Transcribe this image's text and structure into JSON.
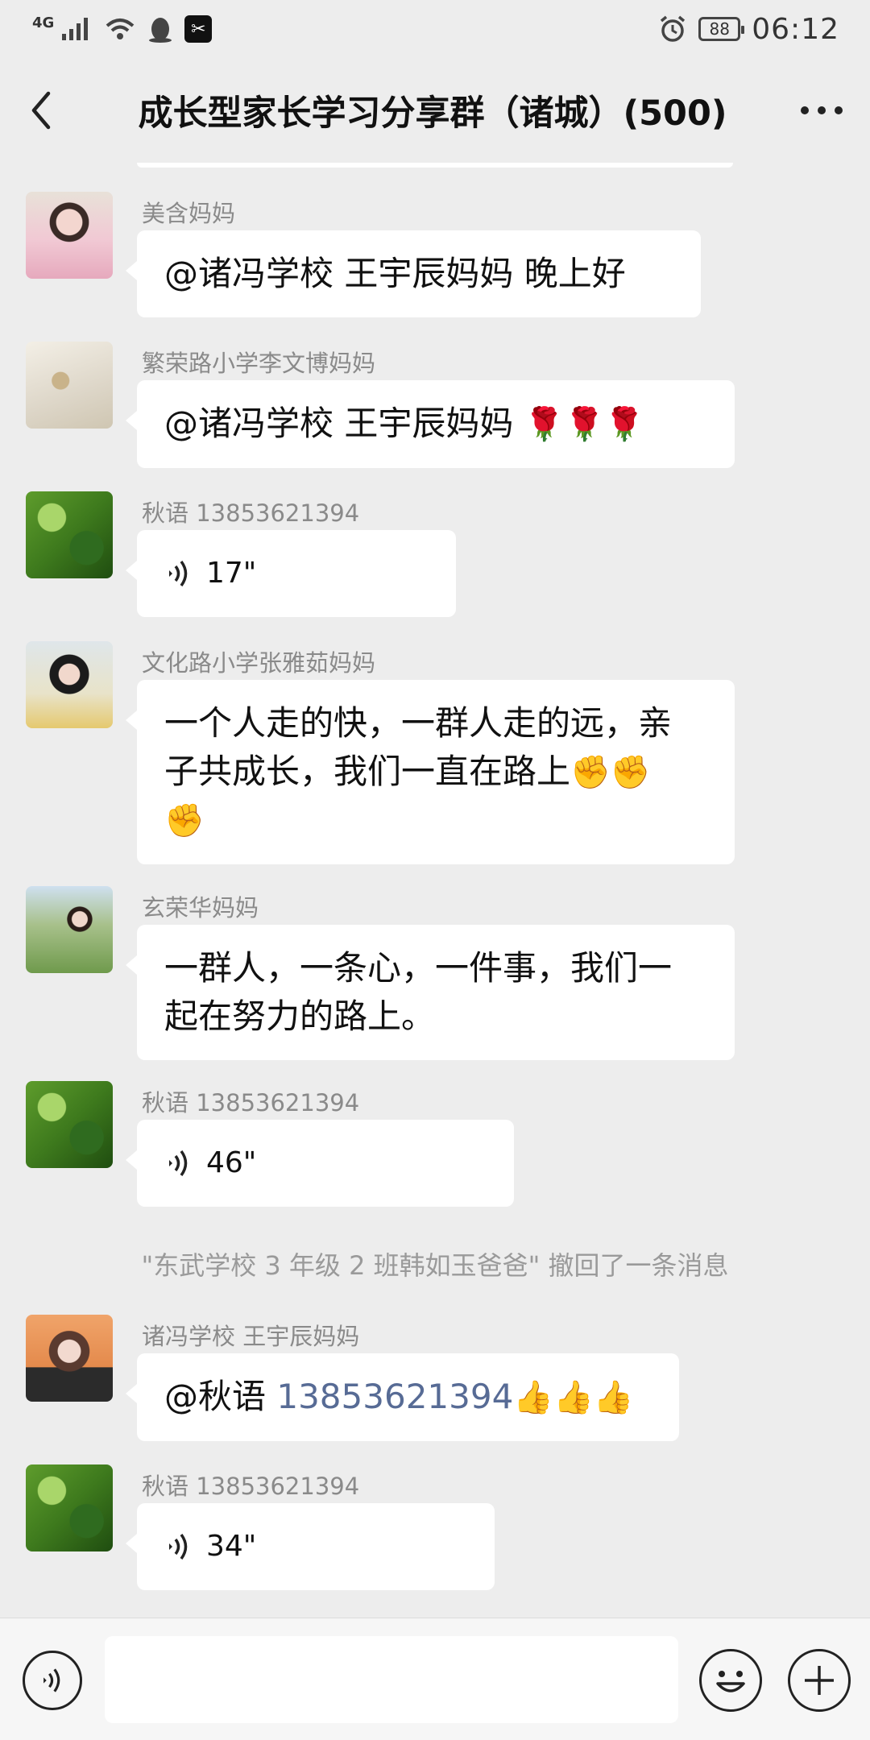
{
  "status_bar": {
    "network": "4G",
    "battery": "88",
    "time": "06:12"
  },
  "header": {
    "title": "成长型家长学习分享群（诸城）(500)"
  },
  "messages": [
    {
      "sender": "美含妈妈",
      "text": "@诸冯学校 王宇辰妈妈  晚上好"
    },
    {
      "sender": "繁荣路小学李文博妈妈",
      "text": "@诸冯学校 王宇辰妈妈 ",
      "emoji": "🌹🌹🌹"
    },
    {
      "sender": "秋语 13853621394",
      "voice_duration": "17\""
    },
    {
      "sender": "文化路小学张雅茹妈妈",
      "text_line1": "一个人走的快，一群人走的远，亲",
      "text_line2": "子共成长，我们一直在路上",
      "emoji_inline": "✊✊",
      "emoji_line3": "✊"
    },
    {
      "sender": "玄荣华妈妈",
      "text_line1": "一群人，一条心，一件事，我们一",
      "text_line2": "起在努力的路上。"
    },
    {
      "sender": "秋语 13853621394",
      "voice_duration": "46\""
    },
    {
      "sender": "诸冯学校 王宇辰妈妈",
      "mention": "@秋语 ",
      "mention_number": "13853621394",
      "emoji": "👍👍👍"
    },
    {
      "sender": "秋语 13853621394",
      "voice_duration": "34\""
    }
  ],
  "system_note": "\"东武学校 3 年级 2 班韩如玉爸爸\" 撤回了一条消息",
  "input_bar": {
    "placeholder": ""
  }
}
